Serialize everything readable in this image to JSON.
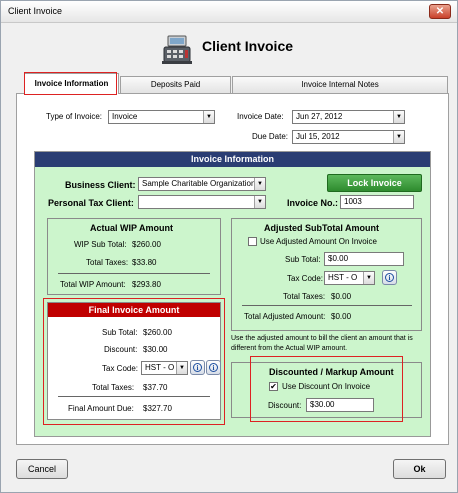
{
  "window": {
    "title": "Client Invoice",
    "close": "✕"
  },
  "header": {
    "title": "Client Invoice",
    "icon": "cash-register-icon"
  },
  "tabs": [
    {
      "label": "Invoice Information"
    },
    {
      "label": "Deposits Paid"
    },
    {
      "label": "Invoice Internal Notes"
    }
  ],
  "top": {
    "type_label": "Type of Invoice:",
    "type_value": "Invoice",
    "invoice_date_label": "Invoice Date:",
    "invoice_date_value": "Jun 27, 2012",
    "due_date_label": "Due Date:",
    "due_date_value": "Jul 15, 2012"
  },
  "section": {
    "title": "Invoice Information",
    "business_client_label": "Business Client:",
    "business_client_value": "Sample Charitable Organization",
    "personal_tax_client_label": "Personal Tax Client:",
    "personal_tax_client_value": "",
    "invoice_no_label": "Invoice No.:",
    "invoice_no_value": "1003",
    "lock_label": "Lock Invoice"
  },
  "actual_wip": {
    "title": "Actual WIP Amount",
    "sub_total_label": "WIP Sub Total:",
    "sub_total_value": "$260.00",
    "taxes_label": "Total Taxes:",
    "taxes_value": "$33.80",
    "total_label": "Total WIP Amount:",
    "total_value": "$293.80"
  },
  "adjusted": {
    "title": "Adjusted SubTotal Amount",
    "use_label": "Use Adjusted Amount On Invoice",
    "use_checked": false,
    "sub_total_label": "Sub Total:",
    "sub_total_value": "$0.00",
    "tax_code_label": "Tax Code:",
    "tax_code_value": "HST - O",
    "taxes_label": "Total Taxes:",
    "taxes_value": "$0.00",
    "total_label": "Total Adjusted Amount:",
    "total_value": "$0.00",
    "note": "Use the adjusted amount to bill the client an amount that is different from the Actual WIP amount."
  },
  "final": {
    "title": "Final Invoice Amount",
    "sub_total_label": "Sub Total:",
    "sub_total_value": "$260.00",
    "discount_label": "Discount:",
    "discount_value": "$30.00",
    "tax_code_label": "Tax Code:",
    "tax_code_value": "HST - O",
    "taxes_label": "Total Taxes:",
    "taxes_value": "$37.70",
    "due_label": "Final Amount Due:",
    "due_value": "$327.70"
  },
  "discount_box": {
    "title": "Discounted / Markup Amount",
    "use_label": "Use Discount On Invoice",
    "use_checked": true,
    "check_mark": "✔",
    "discount_label": "Discount:",
    "discount_value": "$30.00"
  },
  "buttons": {
    "cancel": "Cancel",
    "ok": "Ok"
  },
  "icons": {
    "dropdown": "▼",
    "info": "i"
  }
}
